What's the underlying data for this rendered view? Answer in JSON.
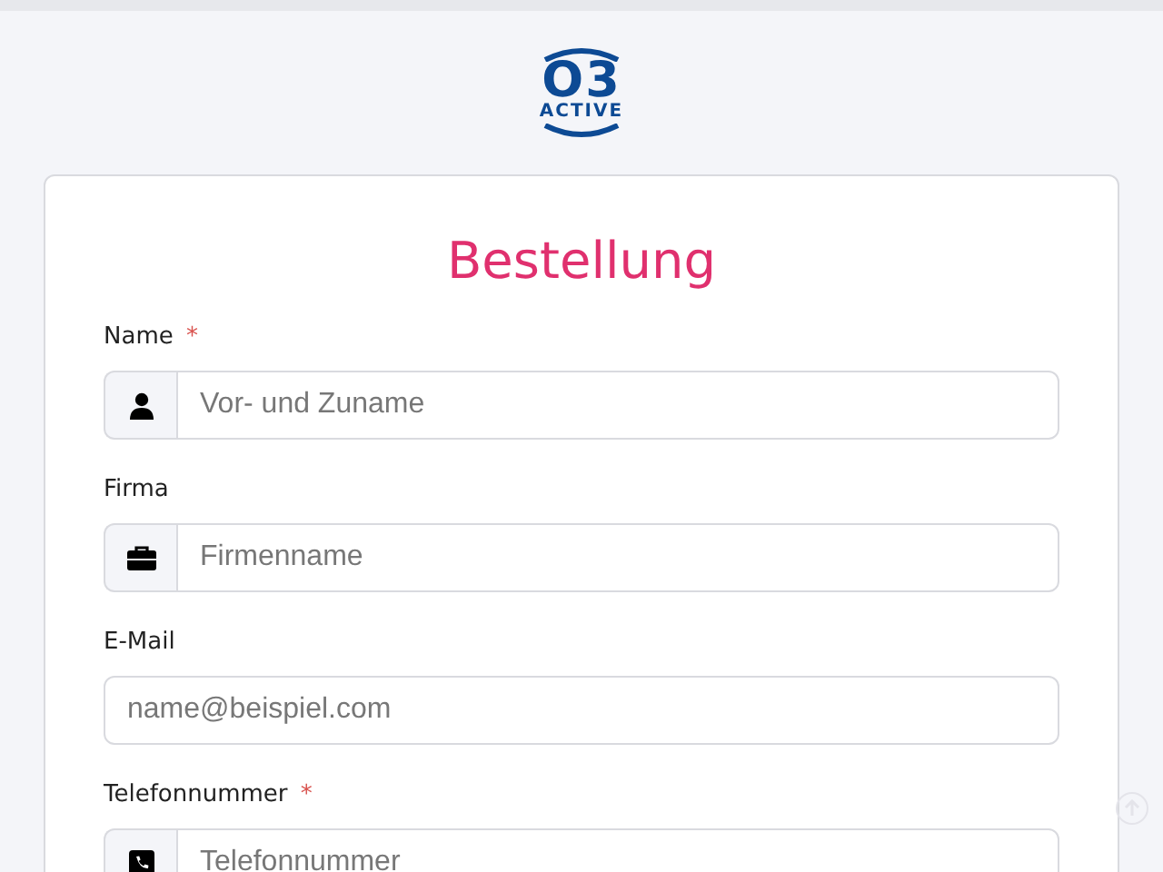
{
  "logo": {
    "top": "O3",
    "bottom": "ACTIVE"
  },
  "title": "Bestellung",
  "fields": [
    {
      "label": "Name",
      "required": true,
      "kind": "person",
      "placeholder": "Vor- und Zuname"
    },
    {
      "label": "Firma",
      "required": false,
      "kind": "briefcase",
      "placeholder": "Firmenname"
    },
    {
      "label": "E-Mail",
      "required": false,
      "kind": "plain",
      "placeholder": "name@beispiel.com"
    },
    {
      "label": "Telefonnummer",
      "required": true,
      "kind": "phone",
      "placeholder": "Telefonnummer"
    }
  ],
  "required_mark": "*"
}
